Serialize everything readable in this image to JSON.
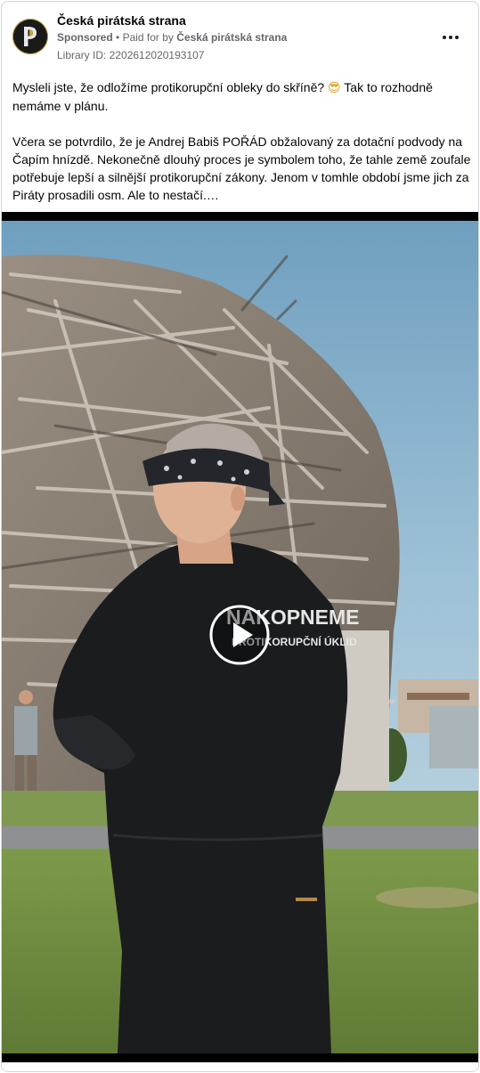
{
  "post": {
    "page_name": "Česká pirátská strana",
    "sponsored_label": "Sponsored",
    "separator": "•",
    "paid_for_prefix": "Paid for by",
    "payer": "Česká pirátská strana",
    "library_id": "Library ID: 2202612020193107",
    "text_line1": "Mysleli jste, že odložíme protikorupční obleky do skříně? ",
    "emoji": "😎",
    "text_line1_end": " Tak to rozhodně nemáme v plánu.",
    "text_paragraph2": "Včera se potvrdilo, že je Andrej Babiš POŘÁD obžalovaný za dotační podvody na Čapím hnízdě. Nekonečně dlouhý proces je symbolem toho, že tahle země zoufale potřebuje lepší a silnější protikorupční zákony. Jenom v tomhle období jsme jich za Piráty prosadili osm. Ale to nestačí.…"
  },
  "video": {
    "jacket_text_line1": "NAKOPNEME",
    "jacket_text_line2": "PROTIKORUPČNÍ ÚKLID"
  },
  "icons": {
    "more": "more-horizontal-icon",
    "play": "play-icon",
    "avatar": "pirate-party-logo"
  }
}
